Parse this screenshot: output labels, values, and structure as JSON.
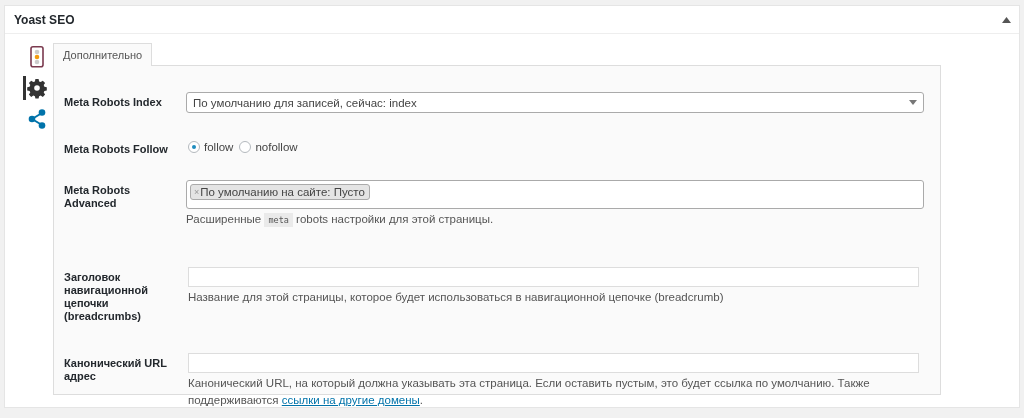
{
  "panel": {
    "title": "Yoast SEO"
  },
  "sidebar": [
    {
      "kind": "traffic-light",
      "selected": false
    },
    {
      "kind": "gear",
      "selected": true
    },
    {
      "kind": "share",
      "selected": false
    }
  ],
  "tabs": [
    {
      "label": "Дополнительно",
      "selected": true
    }
  ],
  "fields": [
    {
      "kind": "select",
      "label": "Meta Robots Index",
      "value": "По умолчанию для записей, сейчас: index"
    },
    {
      "kind": "radio",
      "label": "Meta Robots Follow",
      "options": [
        {
          "label": "follow",
          "selected": true
        },
        {
          "label": "nofollow",
          "selected": false
        }
      ]
    },
    {
      "kind": "tags",
      "label": "Meta Robots Advanced",
      "tags": [
        {
          "remove": "×",
          "label": "По умолчанию на сайте: Пусто"
        }
      ],
      "help": [
        {
          "kind": "text",
          "text": "Расширенные "
        },
        {
          "kind": "code",
          "text": "meta"
        },
        {
          "kind": "text",
          "text": " robots настройки для этой страницы."
        }
      ]
    },
    {
      "kind": "text",
      "label": "Заголовок навигационной цепочки (breadcrumbs)",
      "help": [
        {
          "kind": "text",
          "text": "Название для этой страницы, которое будет использоваться в навигационной цепочке (breadcrumb)"
        }
      ]
    },
    {
      "kind": "text",
      "label": "Канонический URL адрес",
      "help": [
        {
          "kind": "text",
          "text": "Канонический URL, на который должна указывать эта страница. Если оставить пустым, это будет ссылка по умолчанию. Также поддерживаются "
        },
        {
          "kind": "link",
          "text": "ссылки на другие домены"
        },
        {
          "kind": "text",
          "text": "."
        }
      ]
    }
  ]
}
